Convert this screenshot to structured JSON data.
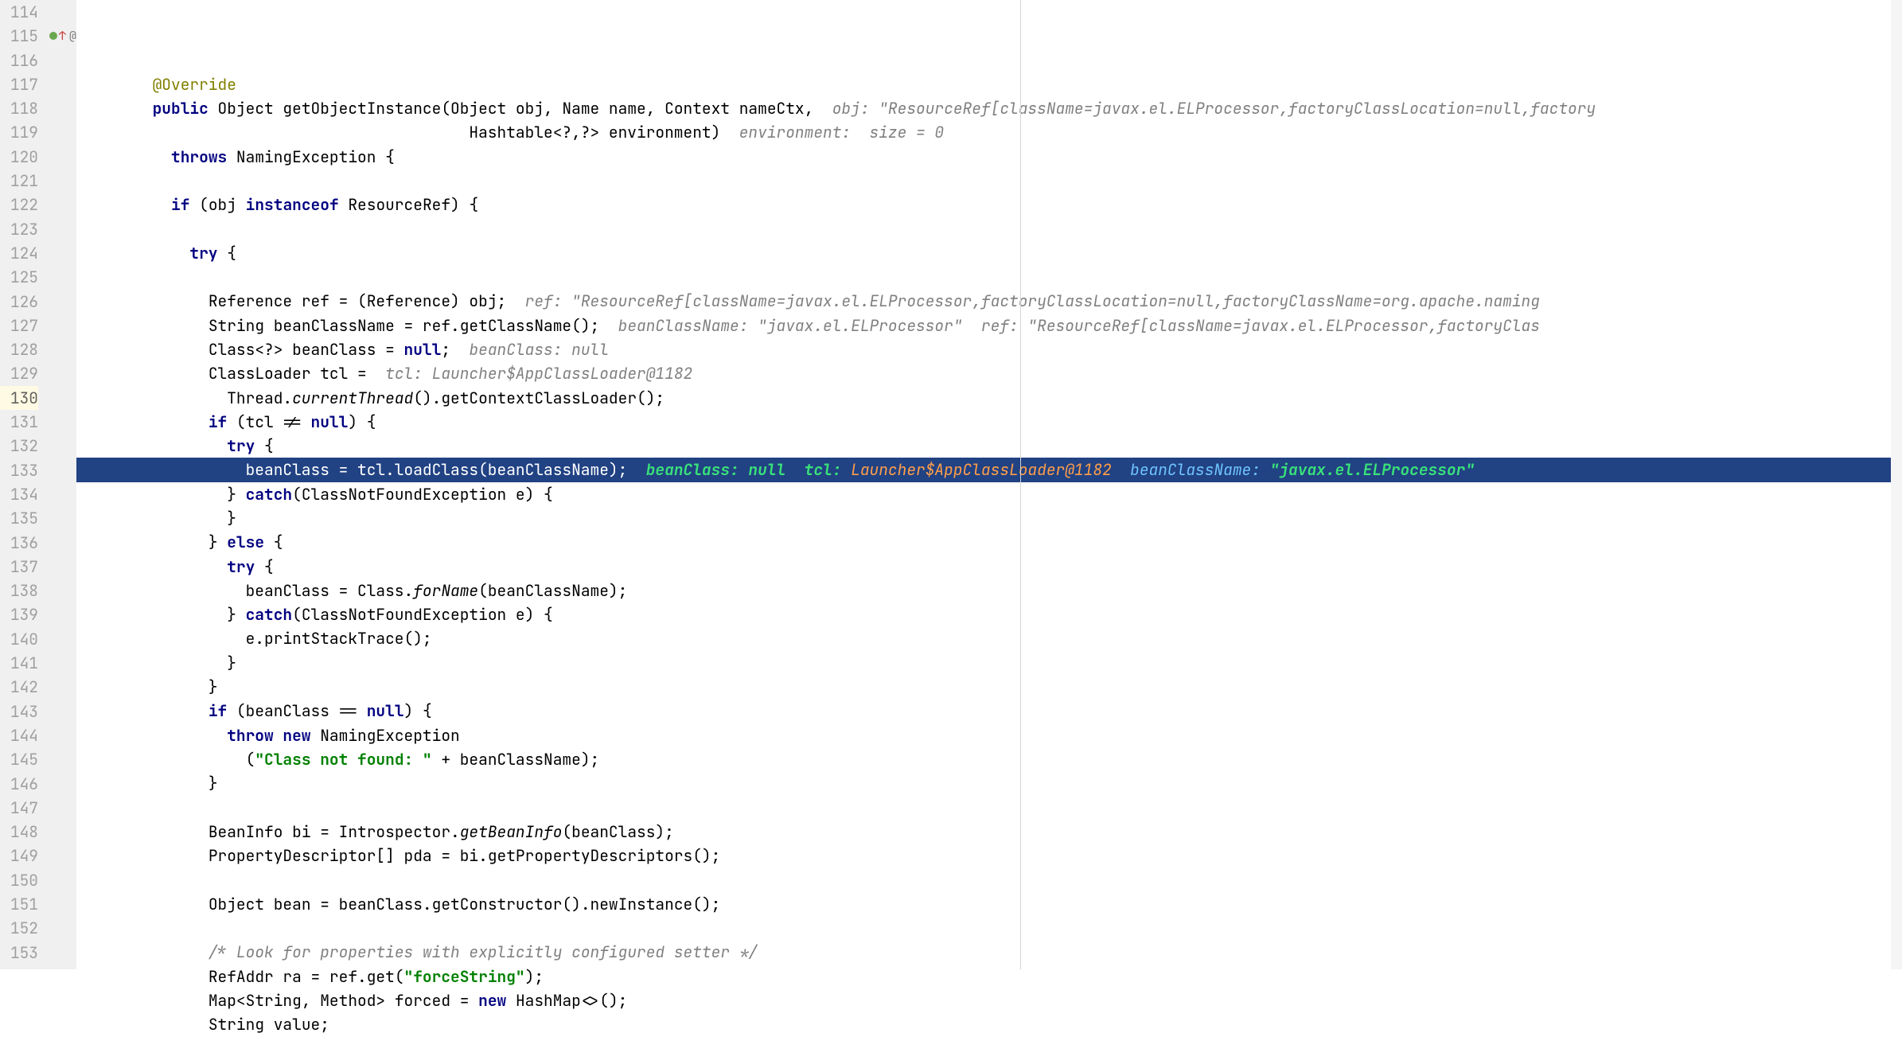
{
  "gutter": {
    "start": 114,
    "end": 153,
    "active_line": 130,
    "icons": {
      "115": "◉↑ @"
    }
  },
  "lines": {
    "l114": {
      "indent": 8,
      "tokens": [
        {
          "t": "@Override",
          "c": "ann"
        }
      ]
    },
    "l115": {
      "indent": 8,
      "tokens": [
        {
          "t": "public ",
          "c": "kw"
        },
        {
          "t": "Object getObjectInstance(Object obj, Name name, Context nameCtx,  "
        },
        {
          "t": "obj: \"ResourceRef[className=javax.el.ELProcessor,factoryClassLocation=null,factory",
          "c": "cmt"
        }
      ]
    },
    "l116": {
      "indent": 42,
      "tokens": [
        {
          "t": "Hashtable<?,?> environment)  "
        },
        {
          "t": "environment:  size = 0",
          "c": "cmt"
        }
      ]
    },
    "l117": {
      "indent": 10,
      "tokens": [
        {
          "t": "throws ",
          "c": "kw"
        },
        {
          "t": "NamingException {"
        }
      ],
      "fold": true
    },
    "l118": {
      "indent": 0,
      "tokens": [
        {
          "t": ""
        }
      ]
    },
    "l119": {
      "indent": 10,
      "tokens": [
        {
          "t": "if ",
          "c": "kw"
        },
        {
          "t": "(obj "
        },
        {
          "t": "instanceof ",
          "c": "kw"
        },
        {
          "t": "ResourceRef) {"
        }
      ]
    },
    "l120": {
      "indent": 0,
      "tokens": [
        {
          "t": ""
        }
      ]
    },
    "l121": {
      "indent": 12,
      "tokens": [
        {
          "t": "try ",
          "c": "kw"
        },
        {
          "t": "{"
        }
      ]
    },
    "l122": {
      "indent": 0,
      "tokens": [
        {
          "t": ""
        }
      ]
    },
    "l123": {
      "indent": 14,
      "tokens": [
        {
          "t": "Reference ref = (Reference) obj;  "
        },
        {
          "t": "ref: \"ResourceRef[className=javax.el.ELProcessor,factoryClassLocation=null,factoryClassName=org.apache.naming",
          "c": "cmt"
        }
      ]
    },
    "l124": {
      "indent": 14,
      "tokens": [
        {
          "t": "String beanClassName = ref.getClassName();  "
        },
        {
          "t": "beanClassName: \"javax.el.ELProcessor\"  ref: \"ResourceRef[className=javax.el.ELProcessor,factoryClas",
          "c": "cmt"
        }
      ]
    },
    "l125": {
      "indent": 14,
      "tokens": [
        {
          "t": "Class<?> beanClass = "
        },
        {
          "t": "null",
          "c": "kw"
        },
        {
          "t": ";  "
        },
        {
          "t": "beanClass: null",
          "c": "cmt"
        }
      ]
    },
    "l126": {
      "indent": 14,
      "tokens": [
        {
          "t": "ClassLoader tcl =  "
        },
        {
          "t": "tcl: Launcher$AppClassLoader@1182",
          "c": "cmt"
        }
      ]
    },
    "l127": {
      "indent": 16,
      "tokens": [
        {
          "t": "Thread."
        },
        {
          "t": "currentThread",
          "c": "sta"
        },
        {
          "t": "().getContextClassLoader();"
        }
      ]
    },
    "l128": {
      "indent": 14,
      "tokens": [
        {
          "t": "if ",
          "c": "kw"
        },
        {
          "t": "(tcl != "
        },
        {
          "t": "null",
          "c": "kw"
        },
        {
          "t": ") {"
        }
      ]
    },
    "l129": {
      "indent": 16,
      "tokens": [
        {
          "t": "try ",
          "c": "kw"
        },
        {
          "t": "{"
        }
      ]
    },
    "l130": {
      "indent": 18,
      "hl": true,
      "tokens": [
        {
          "t": "beanClass = tcl.loadClass(beanClassName);  "
        },
        {
          "t": "beanClass: null  tcl: ",
          "c": "hint-g"
        },
        {
          "t": "Launcher$AppClassLoader@1182",
          "c": "hint-o"
        },
        {
          "t": "  beanClassName: ",
          "c": "hint-b"
        },
        {
          "t": "\"javax.el.ELProcessor\"",
          "c": "hint-g"
        }
      ]
    },
    "l131": {
      "indent": 16,
      "tokens": [
        {
          "t": "} "
        },
        {
          "t": "catch",
          "c": "kw"
        },
        {
          "t": "(ClassNotFoundException e) {"
        }
      ]
    },
    "l132": {
      "indent": 16,
      "tokens": [
        {
          "t": "}"
        }
      ]
    },
    "l133": {
      "indent": 14,
      "tokens": [
        {
          "t": "} "
        },
        {
          "t": "else ",
          "c": "kw"
        },
        {
          "t": "{"
        }
      ]
    },
    "l134": {
      "indent": 16,
      "tokens": [
        {
          "t": "try ",
          "c": "kw"
        },
        {
          "t": "{"
        }
      ]
    },
    "l135": {
      "indent": 18,
      "tokens": [
        {
          "t": "beanClass = Class."
        },
        {
          "t": "forName",
          "c": "sta"
        },
        {
          "t": "(beanClassName);"
        }
      ]
    },
    "l136": {
      "indent": 16,
      "tokens": [
        {
          "t": "} "
        },
        {
          "t": "catch",
          "c": "kw"
        },
        {
          "t": "(ClassNotFoundException e) {"
        }
      ]
    },
    "l137": {
      "indent": 18,
      "tokens": [
        {
          "t": "e.printStackTrace();"
        }
      ]
    },
    "l138": {
      "indent": 16,
      "tokens": [
        {
          "t": "}"
        }
      ]
    },
    "l139": {
      "indent": 14,
      "tokens": [
        {
          "t": "}"
        }
      ]
    },
    "l140": {
      "indent": 14,
      "tokens": [
        {
          "t": "if ",
          "c": "kw"
        },
        {
          "t": "(beanClass == "
        },
        {
          "t": "null",
          "c": "kw"
        },
        {
          "t": ") {"
        }
      ]
    },
    "l141": {
      "indent": 16,
      "tokens": [
        {
          "t": "throw new ",
          "c": "kw"
        },
        {
          "t": "NamingException"
        }
      ]
    },
    "l142": {
      "indent": 18,
      "tokens": [
        {
          "t": "("
        },
        {
          "t": "\"Class not found: \"",
          "c": "str"
        },
        {
          "t": " + beanClassName);"
        }
      ]
    },
    "l143": {
      "indent": 14,
      "tokens": [
        {
          "t": "}"
        }
      ]
    },
    "l144": {
      "indent": 0,
      "tokens": [
        {
          "t": ""
        }
      ]
    },
    "l145": {
      "indent": 14,
      "tokens": [
        {
          "t": "BeanInfo bi = Introspector."
        },
        {
          "t": "getBeanInfo",
          "c": "sta"
        },
        {
          "t": "(beanClass);"
        }
      ]
    },
    "l146": {
      "indent": 14,
      "tokens": [
        {
          "t": "PropertyDescriptor[] pda = bi.getPropertyDescriptors();"
        }
      ]
    },
    "l147": {
      "indent": 0,
      "tokens": [
        {
          "t": ""
        }
      ]
    },
    "l148": {
      "indent": 14,
      "tokens": [
        {
          "t": "Object bean = beanClass.getConstructor().newInstance();"
        }
      ]
    },
    "l149": {
      "indent": 0,
      "tokens": [
        {
          "t": ""
        }
      ]
    },
    "l150": {
      "indent": 14,
      "tokens": [
        {
          "t": "/* Look for properties with explicitly configured setter */",
          "c": "cmt"
        }
      ]
    },
    "l151": {
      "indent": 14,
      "tokens": [
        {
          "t": "RefAddr ra = ref.get("
        },
        {
          "t": "\"forceString\"",
          "c": "str"
        },
        {
          "t": ");"
        }
      ]
    },
    "l152": {
      "indent": 14,
      "tokens": [
        {
          "t": "Map<String, Method> forced = "
        },
        {
          "t": "new ",
          "c": "kw"
        },
        {
          "t": "HashMap<>();"
        }
      ]
    },
    "l153": {
      "indent": 14,
      "tokens": [
        {
          "t": "String value;"
        }
      ]
    }
  }
}
